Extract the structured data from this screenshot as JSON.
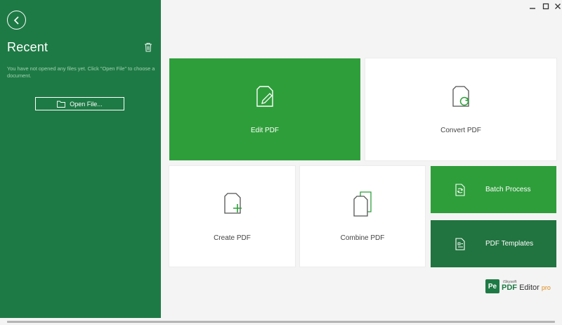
{
  "sidebar": {
    "title": "Recent",
    "empty_message": "You have not opened any files yet. Click \"Open File\" to choose a document.",
    "open_file_label": "Open File..."
  },
  "tiles": {
    "edit": "Edit PDF",
    "convert": "Convert PDF",
    "create": "Create PDF",
    "combine": "Combine PDF",
    "batch": "Batch Process",
    "templates": "PDF Templates"
  },
  "logo": {
    "badge": "Pe",
    "brand": "iSkysoft",
    "name_pdf": "PDF",
    "name_editor": "Editor",
    "name_pro": "pro"
  },
  "colors": {
    "sidebar": "#1e7a45",
    "green_tile": "#2e9e3a",
    "dark_tile": "#21733f",
    "pro_accent": "#e08a1c"
  }
}
